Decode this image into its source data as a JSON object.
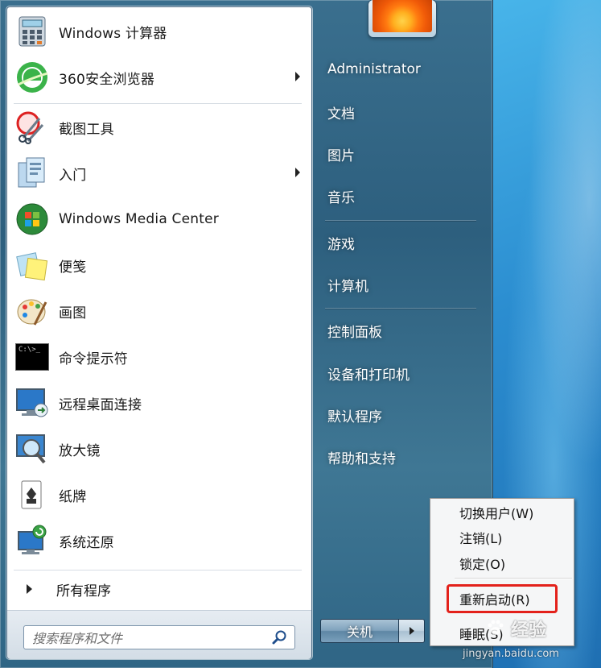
{
  "programs": [
    {
      "label": "Windows 计算器",
      "icon": "calculator-icon",
      "has_submenu": false
    },
    {
      "label": "360安全浏览器",
      "icon": "browser-360-icon",
      "has_submenu": true
    },
    {
      "label": "截图工具",
      "icon": "snipping-tool-icon",
      "has_submenu": false
    },
    {
      "label": "入门",
      "icon": "getting-started-icon",
      "has_submenu": true
    },
    {
      "label": "Windows Media Center",
      "icon": "media-center-icon",
      "has_submenu": false
    },
    {
      "label": "便笺",
      "icon": "sticky-notes-icon",
      "has_submenu": false
    },
    {
      "label": "画图",
      "icon": "paint-icon",
      "has_submenu": false
    },
    {
      "label": "命令提示符",
      "icon": "command-prompt-icon",
      "has_submenu": false
    },
    {
      "label": "远程桌面连接",
      "icon": "remote-desktop-icon",
      "has_submenu": false
    },
    {
      "label": "放大镜",
      "icon": "magnifier-icon",
      "has_submenu": false
    },
    {
      "label": "纸牌",
      "icon": "solitaire-icon",
      "has_submenu": false
    },
    {
      "label": "系统还原",
      "icon": "system-restore-icon",
      "has_submenu": false
    }
  ],
  "all_programs_label": "所有程序",
  "search": {
    "placeholder": "搜索程序和文件"
  },
  "cmd_icon_text": "C:\\>_",
  "right_links": [
    {
      "label": "Administrator"
    },
    {
      "label": "文档"
    },
    {
      "label": "图片"
    },
    {
      "label": "音乐"
    },
    {
      "label": "游戏"
    },
    {
      "label": "计算机"
    },
    {
      "label": "控制面板"
    },
    {
      "label": "设备和打印机"
    },
    {
      "label": "默认程序"
    },
    {
      "label": "帮助和支持"
    }
  ],
  "shutdown": {
    "label": "关机"
  },
  "context_menu": {
    "items": [
      {
        "label": "切换用户(W)"
      },
      {
        "label": "注销(L)"
      },
      {
        "label": "锁定(O)"
      },
      {
        "label": "重新启动(R)"
      },
      {
        "label": "睡眠(S)"
      }
    ]
  },
  "watermark": {
    "brand": "经验",
    "url": "jingyan.baidu.com"
  },
  "colors": {
    "highlight": "#e3211b",
    "menu_glass": "#2d5f7e",
    "left_pane": "#ffffff"
  }
}
